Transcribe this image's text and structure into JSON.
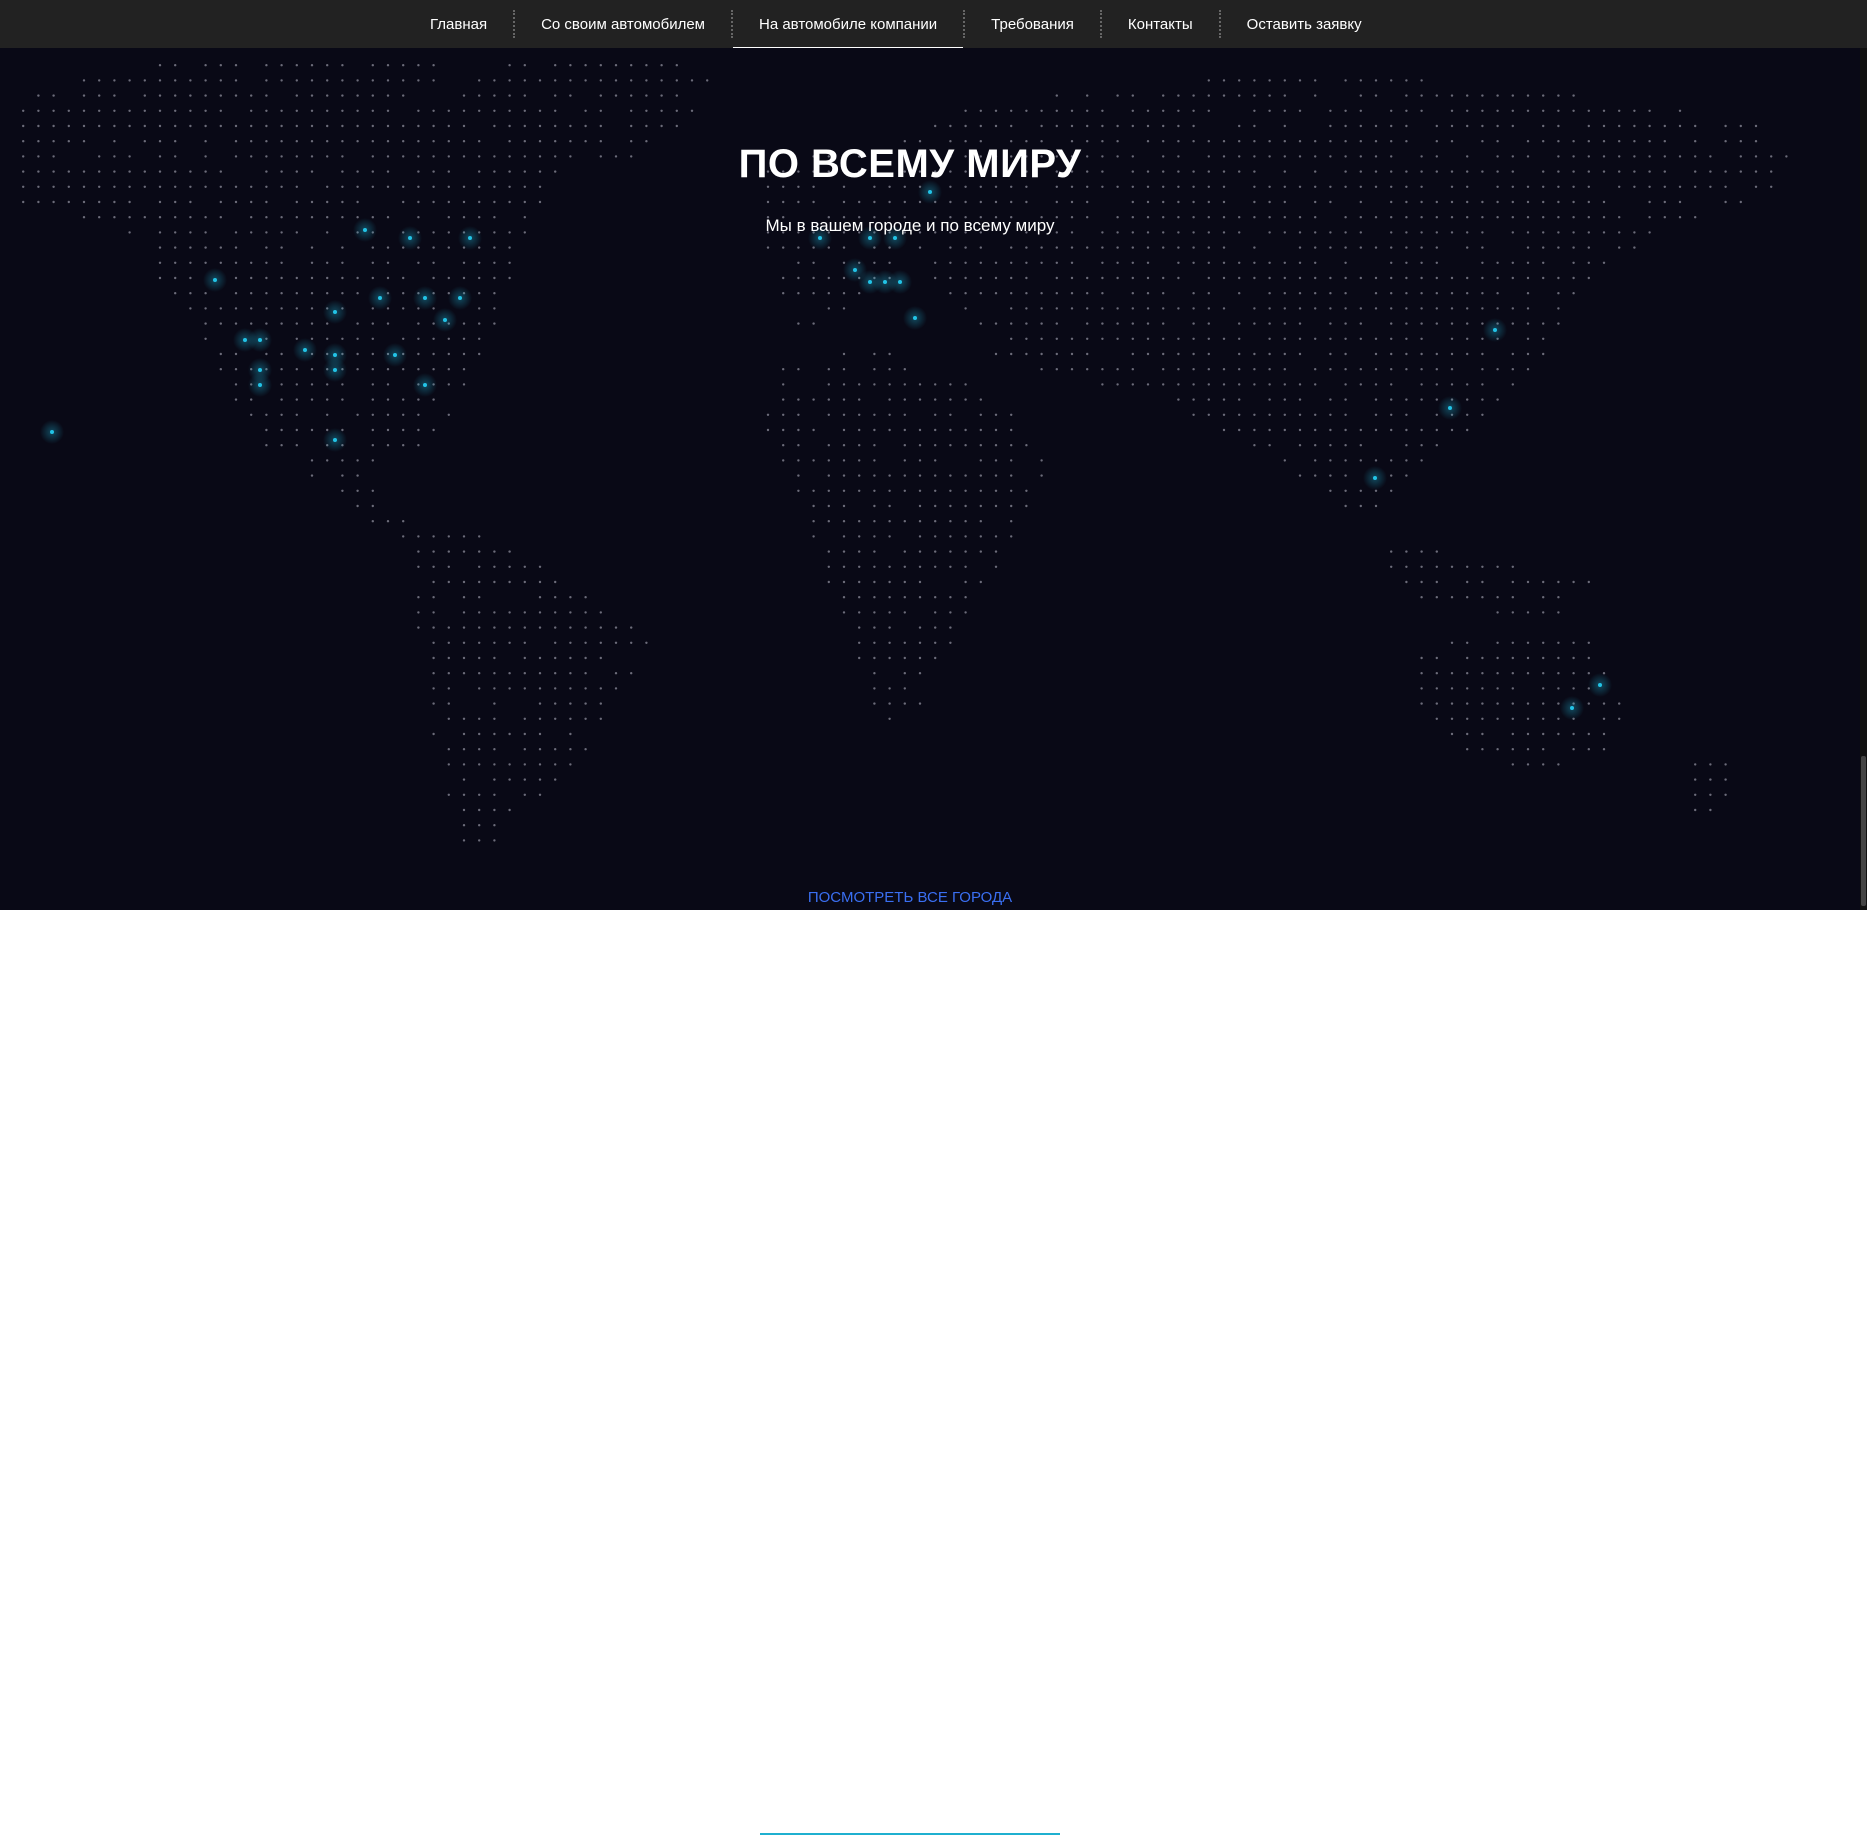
{
  "nav": {
    "items": [
      {
        "label": "Главная",
        "active": false
      },
      {
        "label": "Со своим автомобилем",
        "active": false
      },
      {
        "label": "На автомобиле компании",
        "active": true
      },
      {
        "label": "Требования",
        "active": false
      },
      {
        "label": "Контакты",
        "active": false
      },
      {
        "label": "Оставить заявку",
        "active": false
      }
    ]
  },
  "section": {
    "title": "ПО ВСЕМУ МИРУ",
    "subtitle": "Мы в вашем городе и по всему миру",
    "link_label": "ПОСМОТРЕТЬ ВСЕ ГОРОДА"
  },
  "colors": {
    "background": "#090916",
    "nav_background": "#222222",
    "dot": "#6c6c7a",
    "highlight": "#22c3e6",
    "link": "#3a6ff2"
  }
}
